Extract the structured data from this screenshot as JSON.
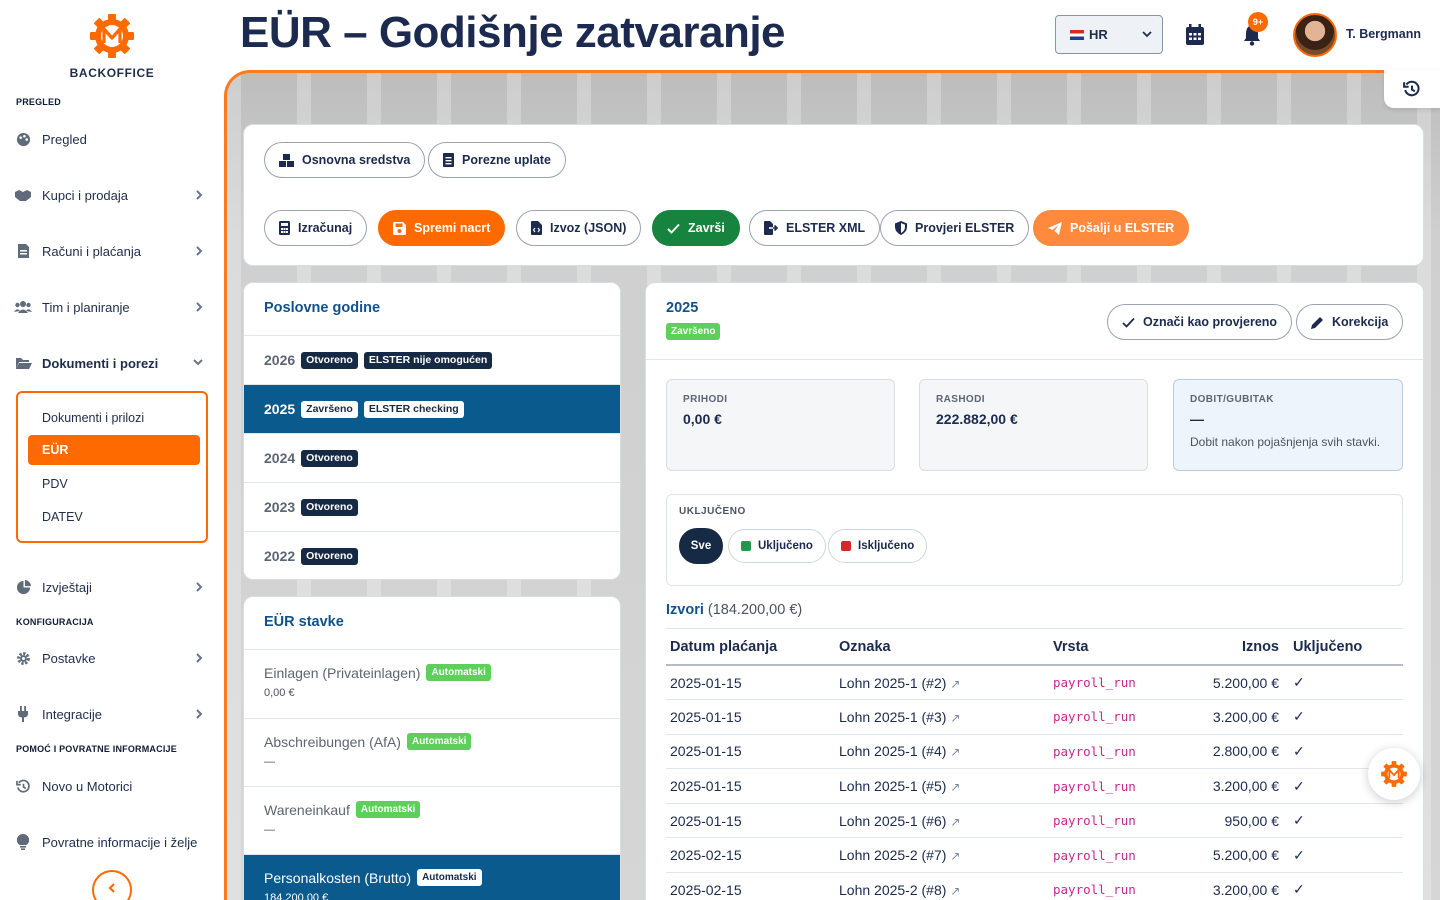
{
  "app": {
    "brand": "BACKOFFICE",
    "title": "EÜR – Godišnje zatvaranje"
  },
  "colors": {
    "accent": "#ff6a00",
    "navy": "#1b2a4e",
    "selected": "#0b5a8e",
    "success": "#16843f"
  },
  "sidebar": {
    "sections": {
      "overview": "PREGLED",
      "config": "KONFIGURACIJA",
      "help": "POMOĆ I POVRATNE INFORMACIJE"
    },
    "items": [
      {
        "label": "Pregled",
        "icon": "palette-icon"
      },
      {
        "label": "Kupci i prodaja",
        "icon": "handshake-icon"
      },
      {
        "label": "Računi i plaćanja",
        "icon": "invoice-icon"
      },
      {
        "label": "Tim i planiranje",
        "icon": "users-icon"
      },
      {
        "label": "Dokumenti i porezi",
        "icon": "folder-open-icon"
      },
      {
        "label": "Izvještaji",
        "icon": "pie-chart-icon"
      },
      {
        "label": "Postavke",
        "icon": "gear-icon"
      },
      {
        "label": "Integracije",
        "icon": "plug-icon"
      },
      {
        "label": "Novo u Motorici",
        "icon": "history-icon"
      },
      {
        "label": "Povratne informacije i želje",
        "icon": "lightbulb-icon"
      }
    ],
    "sub": [
      "Dokumenti i prilozi",
      "EÜR",
      "PDV",
      "DATEV"
    ]
  },
  "header": {
    "language": "HR",
    "notifications": "9+",
    "user": "T. Bergmann"
  },
  "toolbar": {
    "row1": [
      "Osnovna sredstva",
      "Porezne uplate"
    ],
    "row2": [
      "Izračunaj",
      "Spremi nacrt",
      "Izvoz (JSON)",
      "Završi",
      "ELSTER XML",
      "Provjeri ELSTER",
      "Pošalji u ELSTER"
    ]
  },
  "years": {
    "title": "Poslovne godine",
    "rows": [
      {
        "year": "2026",
        "status": "Otvoreno",
        "elster": "ELSTER nije omogućen"
      },
      {
        "year": "2025",
        "status": "Završeno",
        "elster": "ELSTER checking"
      },
      {
        "year": "2024",
        "status": "Otvoreno"
      },
      {
        "year": "2023",
        "status": "Otvoreno"
      },
      {
        "year": "2022",
        "status": "Otvoreno"
      }
    ]
  },
  "items": {
    "title": "EÜR stavke",
    "auto": "Automatski",
    "rows": [
      {
        "name": "Einlagen (Privateinlagen)",
        "value": "0,00 €"
      },
      {
        "name": "Abschreibungen (AfA)",
        "value": "—"
      },
      {
        "name": "Wareneinkauf",
        "value": "—"
      },
      {
        "name": "Personalkosten (Brutto)",
        "value": "184.200,00 €"
      }
    ]
  },
  "detail": {
    "year": "2025",
    "status": "Završeno",
    "mark_checked": "Označi kao provjereno",
    "correction": "Korekcija",
    "kpis": {
      "income_label": "PRIHODI",
      "income": "0,00 €",
      "expense_label": "RASHODI",
      "expense": "222.882,00 €",
      "profit_label": "DOBIT/GUBITAK",
      "profit": "—",
      "profit_note": "Dobit nakon pojašnjenja svih stavki."
    },
    "filter": {
      "label": "UKLJUČENO",
      "all": "Sve",
      "included": "Uključeno",
      "excluded": "Isključeno"
    },
    "sources_label": "Izvori",
    "sources_total": "(184.200,00 €)",
    "columns": [
      "Datum plaćanja",
      "Oznaka",
      "Vrsta",
      "Iznos",
      "Uključeno"
    ],
    "rows": [
      {
        "date": "2025-01-15",
        "label": "Lohn 2025-1 (#2)",
        "type": "payroll_run",
        "amount": "5.200,00 €",
        "inc": "✓"
      },
      {
        "date": "2025-01-15",
        "label": "Lohn 2025-1 (#3)",
        "type": "payroll_run",
        "amount": "3.200,00 €",
        "inc": "✓"
      },
      {
        "date": "2025-01-15",
        "label": "Lohn 2025-1 (#4)",
        "type": "payroll_run",
        "amount": "2.800,00 €",
        "inc": "✓"
      },
      {
        "date": "2025-01-15",
        "label": "Lohn 2025-1 (#5)",
        "type": "payroll_run",
        "amount": "3.200,00 €",
        "inc": "✓"
      },
      {
        "date": "2025-01-15",
        "label": "Lohn 2025-1 (#6)",
        "type": "payroll_run",
        "amount": "950,00 €",
        "inc": "✓"
      },
      {
        "date": "2025-02-15",
        "label": "Lohn 2025-2 (#7)",
        "type": "payroll_run",
        "amount": "5.200,00 €",
        "inc": "✓"
      },
      {
        "date": "2025-02-15",
        "label": "Lohn 2025-2 (#8)",
        "type": "payroll_run",
        "amount": "3.200,00 €",
        "inc": "✓"
      }
    ]
  }
}
